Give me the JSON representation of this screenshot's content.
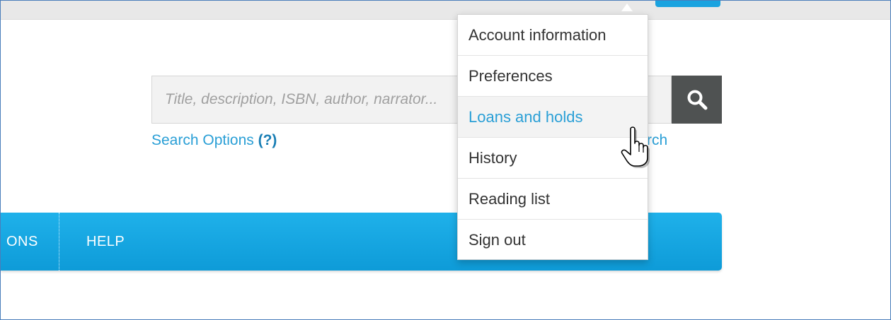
{
  "search": {
    "placeholder": "Title, description, ISBN, author, narrator...",
    "options_label": "Search Options",
    "options_help": "(?)",
    "advanced_label": "nd search"
  },
  "nav": {
    "items": [
      {
        "label": "ONS"
      },
      {
        "label": "HELP"
      }
    ]
  },
  "account_menu": {
    "items": [
      {
        "label": "Account information"
      },
      {
        "label": "Preferences"
      },
      {
        "label": "Loans and holds",
        "hovered": true
      },
      {
        "label": "History"
      },
      {
        "label": "Reading list"
      },
      {
        "label": "Sign out"
      }
    ]
  },
  "colors": {
    "accent": "#2a9fd6",
    "nav_bar": "#0fa3e0",
    "search_button": "#4f5252"
  },
  "icons": {
    "search": "magnifier-icon",
    "cursor": "hand-pointer-icon"
  }
}
